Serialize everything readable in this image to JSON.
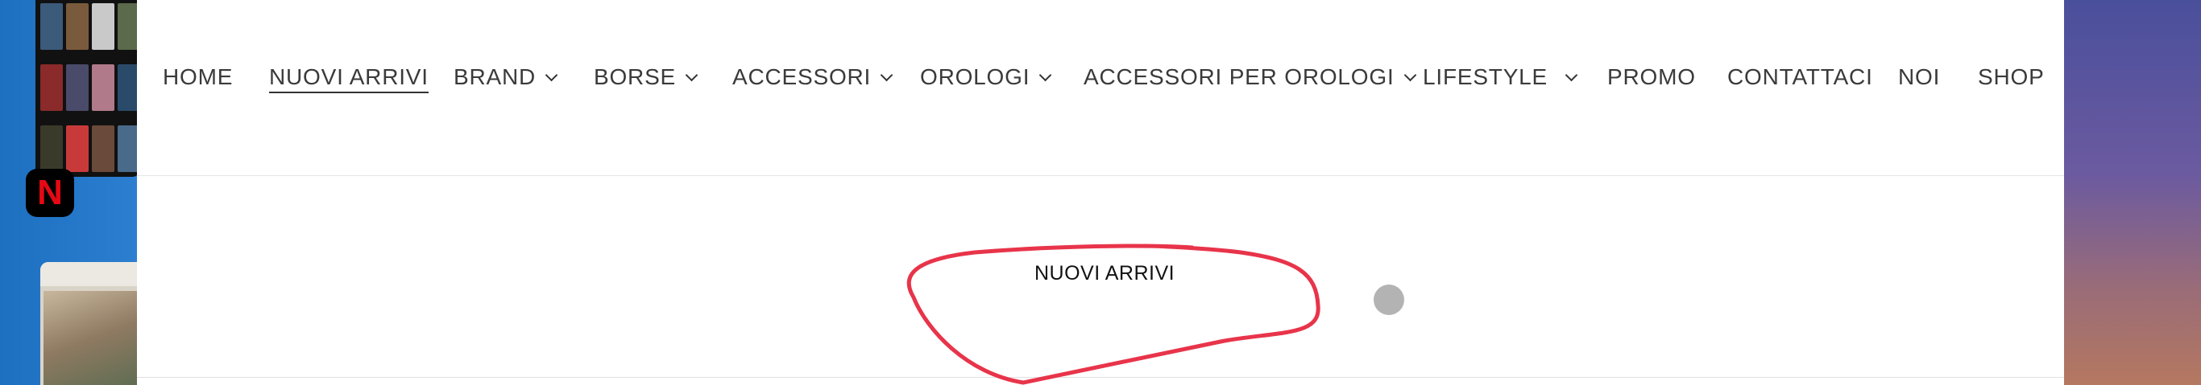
{
  "nav": {
    "items": [
      {
        "label": "HOME",
        "has_dropdown": false,
        "active": false
      },
      {
        "label": "NUOVI ARRIVI",
        "has_dropdown": false,
        "active": true
      },
      {
        "label": "BRAND",
        "has_dropdown": true,
        "active": false
      },
      {
        "label": "BORSE",
        "has_dropdown": true,
        "active": false
      },
      {
        "label": "ACCESSORI",
        "has_dropdown": true,
        "active": false
      },
      {
        "label": "OROLOGI",
        "has_dropdown": true,
        "active": false
      },
      {
        "label": "ACCESSORI PER OROLOGI",
        "has_dropdown": true,
        "active": false
      },
      {
        "label": "LIFESTYLE",
        "has_dropdown": true,
        "active": false
      },
      {
        "label": "PROMO",
        "has_dropdown": false,
        "active": false
      },
      {
        "label": "CONTATTACI",
        "has_dropdown": false,
        "active": false
      },
      {
        "label": "NOI",
        "has_dropdown": false,
        "active": false
      },
      {
        "label": "SHOP",
        "has_dropdown": false,
        "active": false
      }
    ]
  },
  "section": {
    "title": "NUOVI ARRIVI"
  },
  "dock": {
    "netflix_icon": "netflix-icon"
  },
  "colors": {
    "annotation": "#e8344a",
    "pointer": "#b3b3b3",
    "text": "#3a3a3a"
  }
}
